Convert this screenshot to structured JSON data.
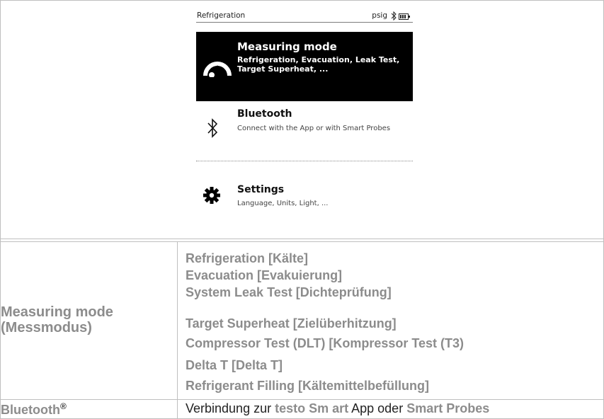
{
  "device_screen": {
    "status_title": "Refrigeration",
    "status_unit": "psig",
    "items": [
      {
        "title": "Measuring mode",
        "description": "Refrigeration, Evacuation, Leak Test, Target Superheat, ...",
        "icon": "gauge-icon",
        "selected": true
      },
      {
        "title": "Bluetooth",
        "description": "Connect with the App or with Smart Probes",
        "icon": "bluetooth-icon",
        "selected": false
      },
      {
        "title": "Settings",
        "description": "Language, Units, Light, ...",
        "icon": "gear-icon",
        "selected": false
      }
    ]
  },
  "table": {
    "row1": {
      "label": "Measuring mode\n(Messmodus)",
      "modes": [
        "Refrigeration [Kälte]",
        "Evacuation [Evakuierung]",
        "System Leak Test [Dichteprüfung]",
        "Target Superheat [Zielüberhitzung]",
        "Compressor Test (DLT) [Kompressor Test (T3)",
        "Delta T [Delta T]",
        "Refrigerant Filling [Kältemittelbefüllung]"
      ]
    },
    "row2": {
      "label": "Bluetooth",
      "label_sup": "®",
      "desc_part1": "Verbindung zur ",
      "desc_highlight1": "testo Sm art",
      "desc_part2": " App oder ",
      "desc_highlight2": "Smart Probes"
    }
  },
  "colors": {
    "label_gray": "#8c8c8c",
    "border": "#bfbfbf",
    "screen_black": "#000000"
  }
}
